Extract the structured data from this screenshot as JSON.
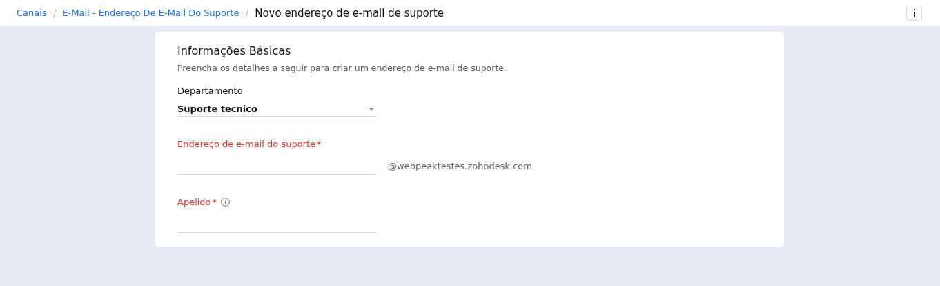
{
  "breadcrumb": [
    {
      "kind": "link",
      "text": "Canais"
    },
    {
      "kind": "separator",
      "text": "/"
    },
    {
      "kind": "link",
      "text": "E-Mail - Endereço De E-Mail Do Suporte"
    },
    {
      "kind": "separator",
      "text": "/"
    },
    {
      "kind": "current",
      "text": "Novo endereço de e-mail de suporte"
    }
  ],
  "section": {
    "title": "Informações Básicas",
    "description": "Preencha os detalhes a seguir para criar um endereço de e-mail de suporte."
  },
  "fields": [
    {
      "kind": "select",
      "label": "Departamento",
      "error": false,
      "value": "Suporte tecnico"
    },
    {
      "kind": "email",
      "label": "Endereço de e-mail do suporte",
      "mark": "*",
      "error": true,
      "suffix": "@webpeaktestes.zohodesk.com"
    },
    {
      "kind": "text",
      "label": "Apelido",
      "mark": "*",
      "error": true,
      "info": true
    }
  ]
}
